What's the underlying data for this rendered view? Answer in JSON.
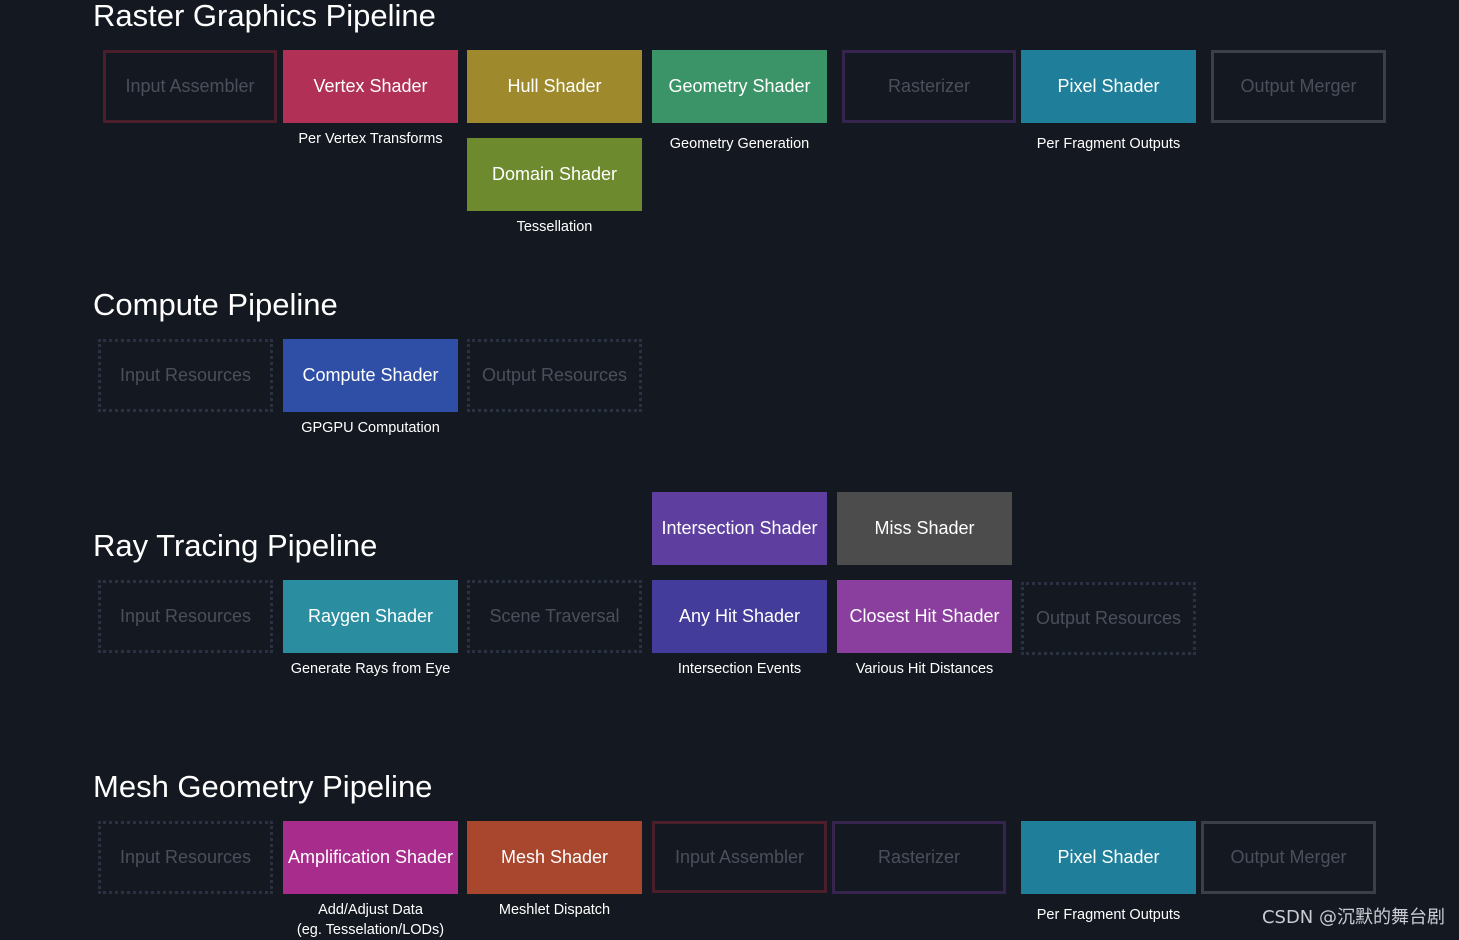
{
  "raster": {
    "title": "Raster Graphics Pipeline",
    "input_assembler": "Input Assembler",
    "vertex_shader": "Vertex Shader",
    "vertex_caption": "Per Vertex Transforms",
    "hull_shader": "Hull Shader",
    "domain_shader": "Domain Shader",
    "domain_caption": "Tessellation",
    "geometry_shader": "Geometry Shader",
    "geometry_caption": "Geometry Generation",
    "rasterizer": "Rasterizer",
    "pixel_shader": "Pixel Shader",
    "pixel_caption": "Per Fragment Outputs",
    "output_merger": "Output Merger"
  },
  "compute": {
    "title": "Compute Pipeline",
    "input_resources": "Input Resources",
    "compute_shader": "Compute Shader",
    "compute_caption": "GPGPU Computation",
    "output_resources": "Output Resources"
  },
  "raytracing": {
    "title": "Ray Tracing Pipeline",
    "input_resources": "Input Resources",
    "raygen_shader": "Raygen Shader",
    "raygen_caption": "Generate Rays from Eye",
    "scene_traversal": "Scene Traversal",
    "intersection_shader": "Intersection Shader",
    "miss_shader": "Miss Shader",
    "any_hit_shader": "Any Hit Shader",
    "any_hit_caption": "Intersection Events",
    "closest_hit_shader": "Closest Hit Shader",
    "closest_hit_caption": "Various Hit Distances",
    "output_resources": "Output Resources"
  },
  "mesh": {
    "title": "Mesh Geometry Pipeline",
    "input_resources": "Input Resources",
    "amplification_shader": "Amplification Shader",
    "amplification_caption_1": "Add/Adjust Data",
    "amplification_caption_2": "(eg. Tesselation/LODs)",
    "mesh_shader": "Mesh Shader",
    "mesh_caption": "Meshlet Dispatch",
    "input_assembler": "Input Assembler",
    "rasterizer": "Rasterizer",
    "pixel_shader": "Pixel Shader",
    "pixel_caption": "Per Fragment Outputs",
    "output_merger": "Output Merger"
  },
  "watermark": "CSDN @沉默的舞台剧",
  "colors": {
    "background": "#141820",
    "vertex": "#b03056",
    "hull": "#9e8a2c",
    "domain": "#6e8a2e",
    "geometry": "#3a9468",
    "pixel": "#1f7f9a",
    "compute": "#2f4fa6",
    "raygen": "#2a8ea0",
    "intersection": "#5e3fa0",
    "miss": "#4c4c4c",
    "any_hit": "#433c9a",
    "closest_hit": "#8a3f9e",
    "amplification": "#a82c8c",
    "mesh": "#a8462e",
    "ghost_border_red": "#4a1e2a",
    "ghost_border_purple": "#36244e",
    "ghost_border_gray": "#3a3f48",
    "ghost_border_dotted": "#2a3142"
  }
}
